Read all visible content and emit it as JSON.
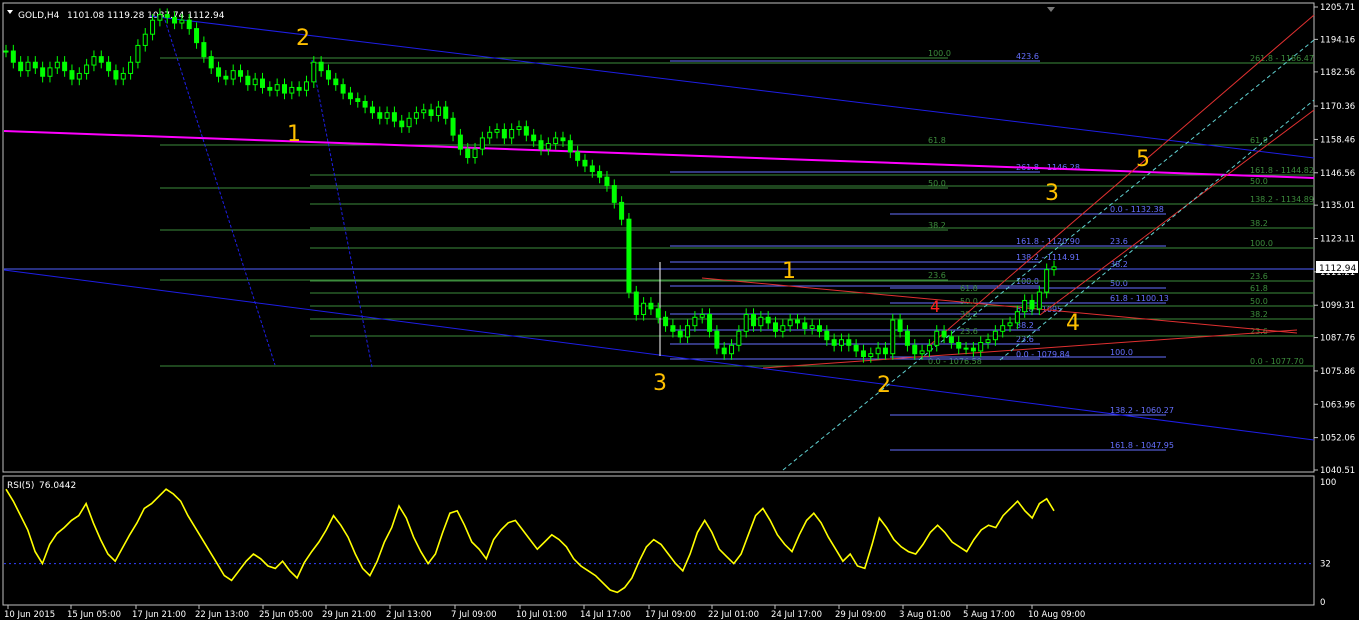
{
  "header": {
    "symbol_timeframe": "GOLD,H4",
    "ohlc": "1101.08 1119.28 1087.74 1112.94"
  },
  "rsi_header": {
    "label": "RSI(5)",
    "value": "76.0442"
  },
  "chart_data": [
    {
      "type": "line",
      "panel": "price",
      "ylim": [
        1040.51,
        1205.71
      ],
      "y_ticks": [
        "1205.71",
        "1194.16",
        "1182.56",
        "1170.36",
        "1158.46",
        "1146.56",
        "1135.01",
        "1123.11",
        "1111.21",
        "1099.31",
        "1087.76",
        "1075.86",
        "1063.96",
        "1052.06",
        "1040.51"
      ],
      "current_price": "1112.94",
      "x_ticks": [
        "10 Jun 2015",
        "15 Jun 05:00",
        "17 Jun 21:00",
        "22 Jun 13:00",
        "25 Jun 05:00",
        "29 Jun 21:00",
        "2 Jul 13:00",
        "7 Jul 09:00",
        "10 Jul 01:00",
        "14 Jul 17:00",
        "17 Jul 09:00",
        "22 Jul 01:00",
        "24 Jul 17:00",
        "29 Jul 09:00",
        "3 Aug 01:00",
        "5 Aug 17:00",
        "10 Aug 09:00"
      ],
      "series": [
        {
          "values": [
            1190,
            1186,
            1183,
            1186,
            1184,
            1181,
            1184,
            1186,
            1183,
            1180,
            1182,
            1185,
            1188,
            1186,
            1183,
            1180,
            1182,
            1186,
            1192,
            1196,
            1201,
            1203,
            1202,
            1200,
            1201,
            1198,
            1193,
            1188,
            1184,
            1181,
            1180,
            1183,
            1181,
            1178,
            1180,
            1177,
            1176,
            1178,
            1175,
            1177,
            1176,
            1179,
            1186,
            1183,
            1180,
            1178,
            1175,
            1173,
            1172,
            1170,
            1168,
            1166,
            1168,
            1165,
            1163,
            1166,
            1168,
            1169,
            1167,
            1170,
            1166,
            1160,
            1155,
            1152,
            1155,
            1159,
            1161,
            1162,
            1159,
            1162,
            1163,
            1160,
            1158,
            1155,
            1157,
            1159,
            1158,
            1154,
            1151,
            1149,
            1147,
            1145,
            1142,
            1136,
            1130,
            1104,
            1096,
            1100,
            1098,
            1095,
            1092,
            1090,
            1088,
            1092,
            1095,
            1096,
            1090,
            1084,
            1082,
            1085,
            1090,
            1096,
            1092,
            1095,
            1093,
            1090,
            1092,
            1094,
            1093,
            1091,
            1092,
            1090,
            1087,
            1085,
            1087,
            1085,
            1083,
            1081,
            1082,
            1084,
            1082,
            1094,
            1090,
            1085,
            1082,
            1083,
            1085,
            1090,
            1088,
            1086,
            1084,
            1084,
            1083,
            1086,
            1087,
            1090,
            1092,
            1093,
            1097,
            1101,
            1098,
            1104,
            1112,
            1113
          ],
          "rsi": [
            94,
            84,
            72,
            60,
            42,
            32,
            48,
            57,
            62,
            68,
            72,
            82,
            66,
            52,
            40,
            34,
            45,
            56,
            66,
            78,
            82,
            88,
            94,
            90,
            84,
            72,
            62,
            52,
            42,
            32,
            22,
            18,
            26,
            34,
            40,
            36,
            30,
            28,
            34,
            26,
            20,
            33,
            42,
            50,
            60,
            72,
            64,
            54,
            40,
            28,
            22,
            34,
            50,
            62,
            80,
            70,
            54,
            42,
            32,
            40,
            58,
            74,
            76,
            64,
            50,
            44,
            36,
            52,
            60,
            66,
            68,
            60,
            52,
            44,
            50,
            56,
            52,
            46,
            36,
            30,
            26,
            22,
            16,
            10,
            8,
            12,
            20,
            34,
            46,
            52,
            48,
            40,
            32,
            26,
            40,
            58,
            68,
            58,
            44,
            38,
            32,
            40,
            56,
            72,
            78,
            68,
            56,
            48,
            42,
            56,
            68,
            74,
            66,
            54,
            44,
            34,
            40,
            30,
            28,
            48,
            70,
            62,
            52,
            46,
            42,
            40,
            48,
            58,
            64,
            58,
            50,
            46,
            42,
            52,
            60,
            64,
            62,
            72,
            78,
            84,
            76,
            70,
            82,
            86,
            76
          ]
        }
      ]
    }
  ],
  "annotations": {
    "wave_labels": [
      "2",
      "1",
      "3",
      "5",
      "3",
      "1",
      "4",
      "2",
      "4"
    ],
    "fib_left": [
      {
        "text": "100.0"
      },
      {
        "text": "61.8"
      },
      {
        "text": "50.0"
      },
      {
        "text": "38.2"
      },
      {
        "text": "23.6"
      },
      {
        "text": "0.0 - 1076.58"
      }
    ],
    "fib_right_blue": [
      {
        "text": "423.6"
      },
      {
        "text": "261.8 - 1146.28"
      },
      {
        "text": "161.8 - 1120.90"
      },
      {
        "text": "138.2 - 1114.91"
      },
      {
        "text": "100.0"
      },
      {
        "text": "61.8 - 1095"
      },
      {
        "text": "38.2"
      },
      {
        "text": "23.6"
      },
      {
        "text": "0.0 - 1079.84"
      }
    ],
    "fib_mid_blue": [
      {
        "text": "0.0 - 1132.38"
      },
      {
        "text": "23.6"
      },
      {
        "text": "38.2"
      },
      {
        "text": "50.0"
      },
      {
        "text": "61.8 - 1100.13"
      },
      {
        "text": "100.0"
      },
      {
        "text": "138.2 - 1060.27"
      },
      {
        "text": "161.8 - 1047.95"
      }
    ],
    "fib_far_green": [
      {
        "text": "261.8 - 1186.47"
      },
      {
        "text": "61.8"
      },
      {
        "text": "161.8 - 1144.82"
      },
      {
        "text": "50.0"
      },
      {
        "text": "138.2 - 1134.89"
      },
      {
        "text": "38.2"
      },
      {
        "text": "100.0"
      },
      {
        "text": "23.6"
      },
      {
        "text": "61.8"
      },
      {
        "text": "50.0"
      },
      {
        "text": "38.2"
      },
      {
        "text": "23.6"
      },
      {
        "text": "0.0 - 1077.70"
      }
    ],
    "extra_levels": [
      {
        "text": "61.8"
      },
      {
        "text": "50.0"
      },
      {
        "text": "38.2"
      },
      {
        "text": "23.6"
      }
    ]
  },
  "rsi_axis": [
    "100",
    "32",
    "0"
  ],
  "colors": {
    "candle": "#00ff00",
    "rsi_line": "#ffff00",
    "wave_label": "#ffc000",
    "channel_blue": "#1e1ee6",
    "trend_magenta": "#ff00ff",
    "fib_green": "#3c8c3c",
    "fib_blue": "#6670ff",
    "red_line": "#e03030",
    "grid_frame": "#c0c0c0"
  }
}
